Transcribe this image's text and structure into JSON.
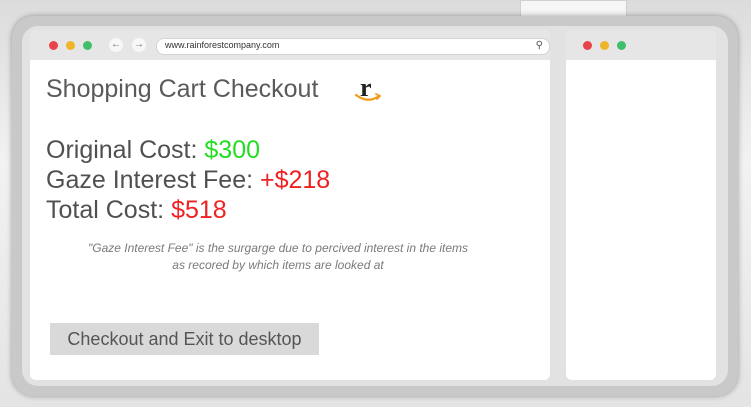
{
  "browser": {
    "url": "www.rainforestcompany.com"
  },
  "page": {
    "title": "Shopping Cart Checkout",
    "logo_letter": "r",
    "original_cost_label": "Original Cost:",
    "original_cost_value": "$300",
    "fee_label": "Gaze Interest Fee:",
    "fee_value": "+$218",
    "total_label": "Total Cost:",
    "total_value": "$518",
    "note_line1": "\"Gaze Interest Fee\" is the surgarge due to percived interest in the items",
    "note_line2": "as recored by which items are looked at",
    "checkout_button": "Checkout and Exit to desktop"
  },
  "colors": {
    "cost_positive": "#22dd22",
    "cost_negative": "#ee2222",
    "dot_close": "#e8434a",
    "dot_minimize": "#f0b429",
    "dot_maximize": "#3fbf6a"
  },
  "icons": {
    "back": "back-arrow-icon",
    "forward": "forward-arrow-icon",
    "search": "search-icon",
    "menu": "kebab-menu-icon"
  }
}
